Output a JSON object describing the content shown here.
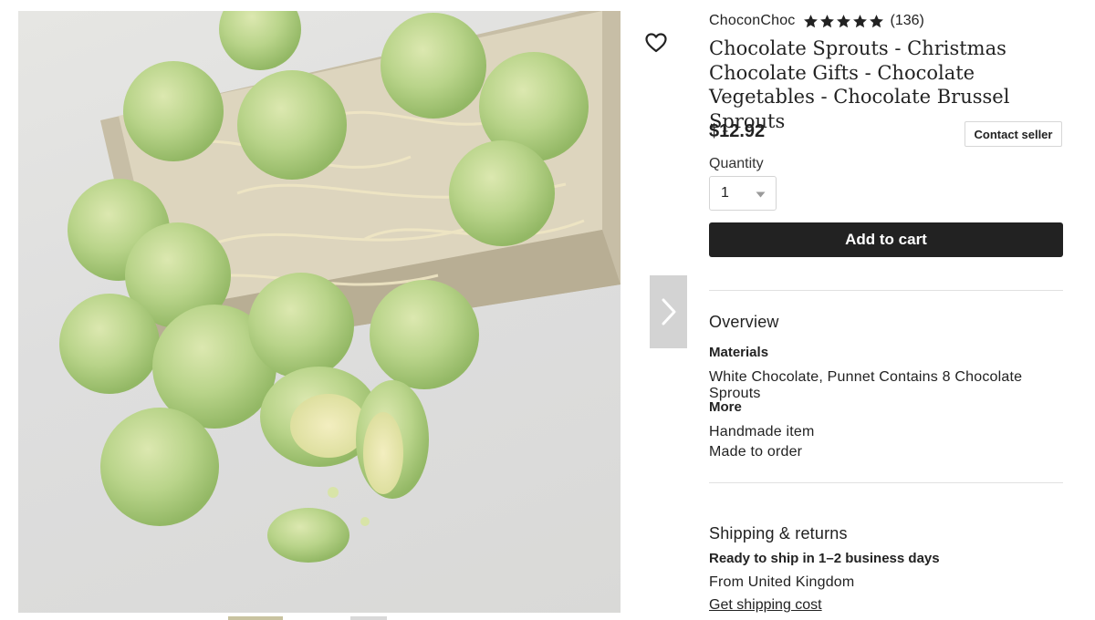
{
  "image": {
    "alt_subject": "chocolate brussels sprouts"
  },
  "icons": {
    "favorite": "heart-outline-icon",
    "next_image": "chevron-right-icon",
    "star": "star-icon",
    "caret": "caret-down-icon"
  },
  "shop": {
    "name": "ChoconChoc",
    "rating_stars": 5,
    "review_count": "(136)"
  },
  "product": {
    "title": "Chocolate Sprouts - Christmas Chocolate Gifts - Chocolate Vegetables - Chocolate Brussel Sprouts",
    "price": "$12.92"
  },
  "actions": {
    "contact_seller": "Contact seller",
    "add_to_cart": "Add to cart"
  },
  "quantity": {
    "label": "Quantity",
    "selected": "1"
  },
  "overview": {
    "heading": "Overview",
    "materials_label": "Materials",
    "materials_value": "White Chocolate, Punnet Contains 8 Chocolate Sprouts",
    "more_label": "More",
    "handmade": "Handmade item",
    "made_to_order": "Made to order"
  },
  "shipping": {
    "heading": "Shipping & returns",
    "ready": "Ready to ship in 1–2 business days",
    "from": "From United Kingdom",
    "cost_link": "Get shipping cost"
  },
  "colors": {
    "button_dark": "#222222",
    "text": "#222222",
    "sprout_green": "#b7d38a",
    "punnet": "#cfc6b0"
  }
}
